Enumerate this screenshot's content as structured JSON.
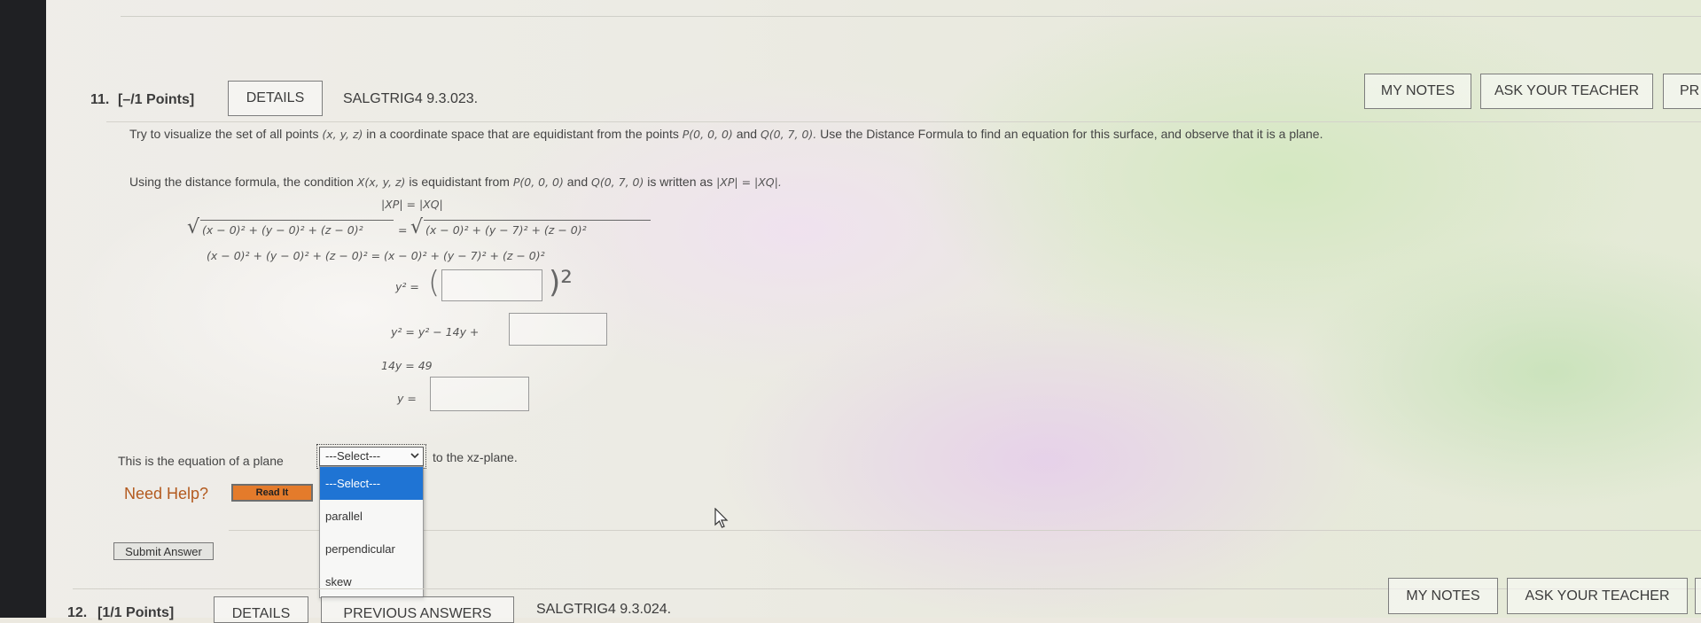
{
  "question": {
    "number": "11.",
    "points": "[–/1 Points]",
    "details_label": "DETAILS",
    "code": "SALGTRIG4 9.3.023.",
    "my_notes_label": "MY NOTES",
    "ask_teacher_label": "ASK YOUR TEACHER",
    "practice_label": "PR",
    "prompt_part1": "Try to visualize the set of all points",
    "prompt_xyz": "(x, y, z)",
    "prompt_part2": "in a coordinate space that are equidistant from the points",
    "prompt_p": "P(0, 0, 0)",
    "prompt_and": "and",
    "prompt_q": "Q(0, 7, 0).",
    "prompt_part3": "Use the Distance Formula to find an equation for this surface, and observe that it is a plane.",
    "condition_part1": "Using the distance formula, the condition",
    "condition_x": "X(x, y, z)",
    "condition_part2": "is equidistant from",
    "condition_p": "P(0, 0, 0)",
    "condition_and": "and",
    "condition_q": "Q(0, 7, 0)",
    "condition_part3": "is written as",
    "condition_eq": "|XP| = |XQ|.",
    "eq1": "|XP| = |XQ|",
    "eq2_left": "(x − 0)² + (y − 0)² + (z − 0)²",
    "eq2_mid": "=",
    "eq2_right": "(x − 0)² + (y − 7)² + (z − 0)²",
    "eq3": "(x − 0)² + (y − 0)² + (z − 0)² = (x − 0)² + (y − 7)² + (z − 0)²",
    "eq4_left": "y² =",
    "eq4_close": ")²",
    "eq4_open": "(",
    "eq5_left": "y² = y² − 14y +",
    "eq6": "14y = 49",
    "eq7_left": "y =",
    "plane_text_before": "This is the equation of a plane",
    "plane_text_after": "to the xz-plane.",
    "select_value": "---Select---",
    "select_options": [
      "---Select---",
      "parallel",
      "perpendicular",
      "skew"
    ],
    "need_help": "Need Help?",
    "read_it": "Read It",
    "submit": "Submit Answer"
  },
  "next_question": {
    "number": "12.",
    "points": "[1/1 Points]",
    "details_label": "DETAILS",
    "previous_answers_label": "PREVIOUS ANSWERS",
    "code": "SALGTRIG4 9.3.024.",
    "my_notes_label": "MY NOTES",
    "ask_teacher_label": "ASK YOUR TEACHER"
  },
  "colors": {
    "accent_select": "#1f74d4",
    "read_it_orange": "#e47b2b",
    "need_help": "#b35a1f"
  }
}
